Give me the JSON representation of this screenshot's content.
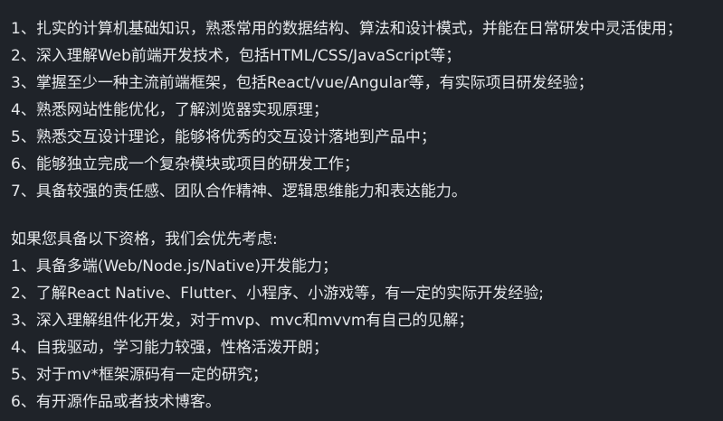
{
  "requirements": [
    "1、扎实的计算机基础知识，熟悉常用的数据结构、算法和设计模式，并能在日常研发中灵活使用；",
    "2、深入理解Web前端开发技术，包括HTML/CSS/JavaScript等；",
    "3、掌握至少一种主流前端框架，包括React/vue/Angular等，有实际项目研发经验；",
    "4、熟悉网站性能优化，了解浏览器实现原理；",
    "5、熟悉交互设计理论，能够将优秀的交互设计落地到产品中；",
    "6、能够独立完成一个复杂模块或项目的研发工作；",
    "7、具备较强的责任感、团队合作精神、逻辑思维能力和表达能力。"
  ],
  "bonus_title": "如果您具备以下资格，我们会优先考虑:",
  "bonus": [
    "1、具备多端(Web/Node.js/Native)开发能力；",
    "2、了解React Native、Flutter、小程序、小游戏等，有一定的实际开发经验;",
    "3、深入理解组件化开发，对于mvp、mvc和mvvm有自己的见解；",
    "4、自我驱动，学习能力较强，性格活泼开朗；",
    "5、对于mv*框架源码有一定的研究；",
    "6、有开源作品或者技术博客。"
  ]
}
